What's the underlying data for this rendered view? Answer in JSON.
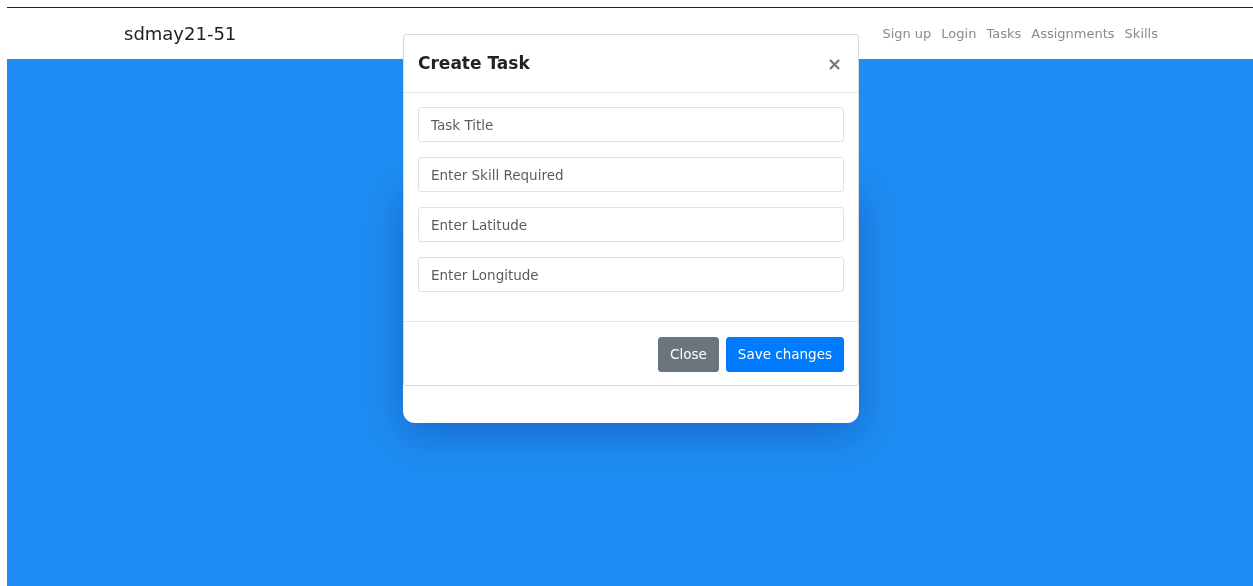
{
  "navbar": {
    "brand": "sdmay21-51",
    "links": [
      "Sign up",
      "Login",
      "Tasks",
      "Assignments",
      "Skills"
    ]
  },
  "modal": {
    "title": "Create Task",
    "close": "×",
    "fields": [
      {
        "placeholder": "Task Title"
      },
      {
        "placeholder": "Enter Skill Required"
      },
      {
        "placeholder": "Enter Latitude"
      },
      {
        "placeholder": "Enter Longitude"
      }
    ],
    "buttons": [
      {
        "label": "Close",
        "kind": "secondary"
      },
      {
        "label": "Save changes",
        "kind": "primary"
      }
    ]
  }
}
